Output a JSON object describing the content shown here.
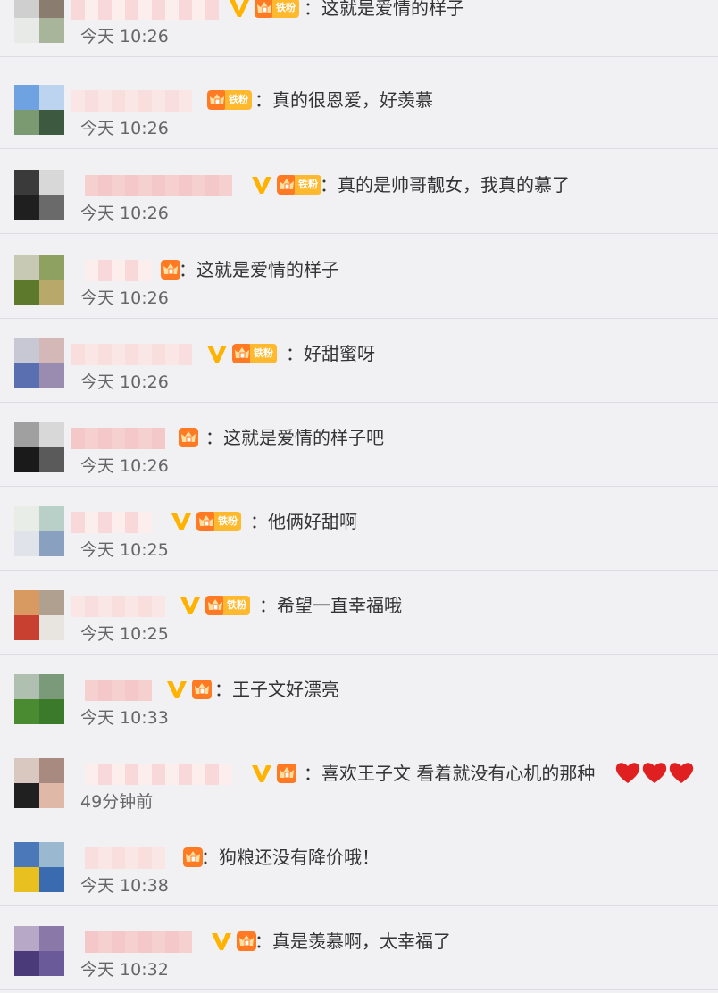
{
  "comments": [
    {
      "text": "：这就是爱情的样子",
      "time": "今天 10:26",
      "verified": true,
      "fan_badge": "铁粉",
      "colors": [
        "#cfcfcf",
        "#8a7d70",
        "#e8eae8",
        "#a8b59a"
      ]
    },
    {
      "text": "：真的很恩爱，好羡慕",
      "time": "今天 10:26",
      "verified": false,
      "fan_badge": "铁粉",
      "colors": [
        "#6ea2e0",
        "#bcd4f0",
        "#7b9a72",
        "#3d5a40"
      ]
    },
    {
      "text": "：真的是帅哥靓女，我真的慕了",
      "time": "今天 10:26",
      "verified": true,
      "fan_badge": "铁粉",
      "colors": [
        "#3a3a3a",
        "#d8d8d8",
        "#1f1f1f",
        "#6a6a6a"
      ]
    },
    {
      "text": "：这就是爱情的样子",
      "time": "今天 10:26",
      "verified": false,
      "fan_badge": "",
      "colors": [
        "#c7c9b4",
        "#8fa161",
        "#5d7a2c",
        "#b8a869"
      ]
    },
    {
      "text": "：好甜蜜呀",
      "time": "今天 10:26",
      "verified": true,
      "fan_badge": "铁粉",
      "colors": [
        "#c8c8d4",
        "#d4b8b8",
        "#5a6fb0",
        "#9a8cb0"
      ]
    },
    {
      "text": "：这就是爱情的样子吧",
      "time": "今天 10:26",
      "verified": false,
      "fan_badge": "",
      "colors": [
        "#a0a0a0",
        "#d8d8d8",
        "#1a1a1a",
        "#5a5a5a"
      ]
    },
    {
      "text": "：他俩好甜啊",
      "time": "今天 10:25",
      "verified": true,
      "fan_badge": "铁粉",
      "colors": [
        "#e8ede8",
        "#b8d0c8",
        "#e0e4ea",
        "#8aa0c0"
      ]
    },
    {
      "text": "：希望一直幸福哦",
      "time": "今天 10:25",
      "verified": true,
      "fan_badge": "铁粉",
      "colors": [
        "#d89a60",
        "#b0a090",
        "#c84030",
        "#e8e4e0"
      ]
    },
    {
      "text": "：王子文好漂亮",
      "time": "今天 10:33",
      "verified": true,
      "fan_badge": "",
      "colors": [
        "#b0c0b0",
        "#7a9a7a",
        "#4a8a30",
        "#3a7a2a"
      ]
    },
    {
      "text": "：喜欢王子文 看着就没有心机的那种",
      "time": "49分钟前",
      "verified": true,
      "fan_badge": "",
      "hearts": 3,
      "colors": [
        "#d8c8c0",
        "#a88a80",
        "#202020",
        "#e0b8a8"
      ]
    },
    {
      "text": "：狗粮还没有降价哦！",
      "time": "今天 10:38",
      "verified": false,
      "fan_badge": "",
      "colors": [
        "#4a78b8",
        "#9ab8d0",
        "#e8c020",
        "#3a6ab0"
      ]
    },
    {
      "text": "：真是羡慕啊，太幸福了",
      "time": "今天 10:32",
      "verified": true,
      "fan_badge": "",
      "colors": [
        "#b8a8c8",
        "#8a78a8",
        "#4a3a7a",
        "#6a5a9a"
      ]
    }
  ],
  "colors": {
    "background": "#f1f1f4",
    "divider": "#dcdce2",
    "verified_badge": "#ffb300",
    "fan_crown": "#ff7a23",
    "fan_level": "#ffb92e",
    "time_text": "#666666",
    "comment_text": "#333333",
    "heart": "#e02020"
  },
  "icons": {
    "verified": "verified-v-icon",
    "fan": "fan-crown-icon",
    "heart": "heart-emoji"
  }
}
